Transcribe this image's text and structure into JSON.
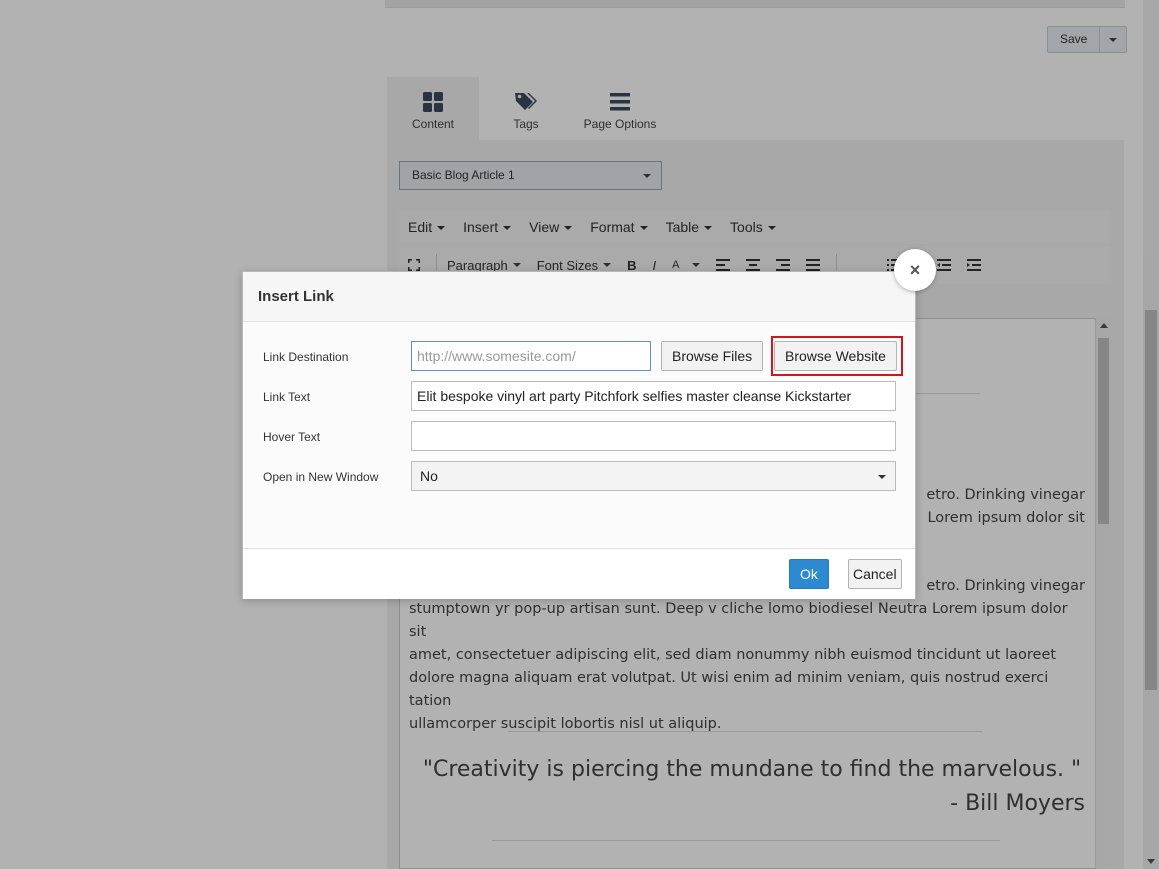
{
  "header": {
    "save_label": "Save"
  },
  "tabs": [
    {
      "label": "Content",
      "icon": "grid-icon"
    },
    {
      "label": "Tags",
      "icon": "tags-icon"
    },
    {
      "label": "Page Options",
      "icon": "menu-icon"
    }
  ],
  "template_select": {
    "value": "Basic Blog Article 1"
  },
  "editor": {
    "menu": [
      "Edit",
      "Insert",
      "View",
      "Format",
      "Table",
      "Tools"
    ],
    "toolbar": {
      "paragraph": "Paragraph",
      "font_sizes": "Font Sizes",
      "bold": "B",
      "italic": "I",
      "font_color": "A"
    },
    "content": {
      "para1_line1": "etro. Drinking vinegar",
      "para1_line2": "Lorem ipsum dolor sit",
      "para2_line1": "etro. Drinking vinegar",
      "para2_line2": "stumptown yr pop-up artisan sunt. Deep v cliche lomo biodiesel Neutra Lorem ipsum dolor sit",
      "para2_line3": "amet, consectetuer adipiscing elit, sed diam nonummy nibh euismod tincidunt ut laoreet",
      "para2_line4": "dolore magna aliquam erat volutpat. Ut wisi enim ad minim veniam, quis nostrud exerci tation",
      "para2_line5": "ullamcorper suscipit lobortis nisl ut aliquip.",
      "quote": "\"Creativity is piercing the mundane to find the marvelous. \"",
      "quote_author": "- Bill Moyers"
    }
  },
  "modal": {
    "title": "Insert Link",
    "close_label": "×",
    "fields": {
      "destination_label": "Link Destination",
      "destination_placeholder": "http://www.somesite.com/",
      "destination_value": "",
      "text_label": "Link Text",
      "text_value": "Elit bespoke vinyl art party Pitchfork selfies master cleanse Kickstarter",
      "hover_label": "Hover Text",
      "hover_value": "",
      "new_window_label": "Open in New Window",
      "new_window_value": "No"
    },
    "buttons": {
      "browse_files": "Browse Files",
      "browse_website": "Browse Website",
      "ok": "Ok",
      "cancel": "Cancel"
    }
  },
  "colors": {
    "primary": "#2d8ad0",
    "highlight": "#d0161b"
  }
}
